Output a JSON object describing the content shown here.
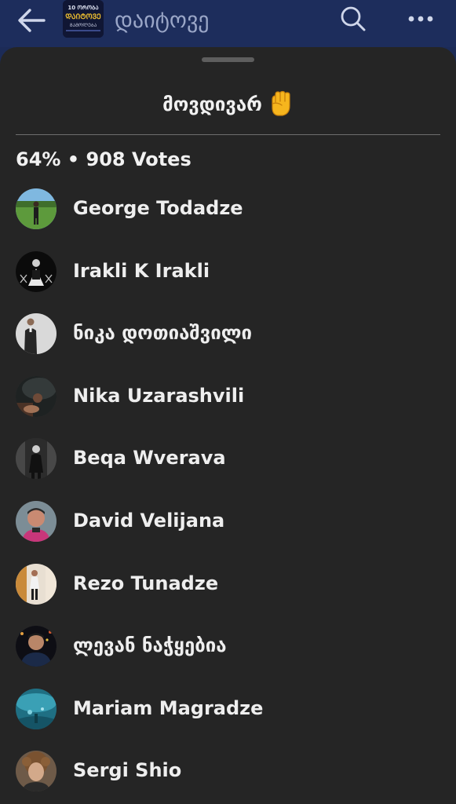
{
  "header": {
    "title": "დაიტოვე",
    "back_icon": "arrow-left-icon",
    "search_icon": "search-icon",
    "more_icon": "more-horizontal-icon",
    "thumb_text": [
      "10 ᲝᲠᲝᲑᲐ",
      "ᲓᲐᲘᲢᲝᲕᲔ",
      "ᲒᲐᲛᲝᲚᲔᲑᲐ"
    ]
  },
  "sheet": {
    "title": "მოვდივარ",
    "title_icon": "raised-fist-emoji",
    "summary": "64% • 908 Votes"
  },
  "voters": [
    {
      "name": "George Todadze",
      "avatar_icon": "person-on-grass-photo"
    },
    {
      "name": "Irakli K Irakli",
      "avatar_icon": "dark-portrait-photo"
    },
    {
      "name": "ნიკა დოთიაშვილი",
      "avatar_icon": "person-in-suit-photo"
    },
    {
      "name": "Nika Uzarashvili",
      "avatar_icon": "dark-outdoor-photo"
    },
    {
      "name": "Beqa Wverava",
      "avatar_icon": "person-dark-room-photo"
    },
    {
      "name": "David Velijana",
      "avatar_icon": "man-portrait-photo"
    },
    {
      "name": "Rezo Tunadze",
      "avatar_icon": "person-standing-photo"
    },
    {
      "name": "ლევან ნაჭყებია",
      "avatar_icon": "man-night-photo"
    },
    {
      "name": "Mariam Magradze",
      "avatar_icon": "aquarium-photo"
    },
    {
      "name": "Sergi Shio",
      "avatar_icon": "curly-hair-portrait-photo"
    }
  ],
  "colors": {
    "topbar_bg": "#1d2d5c",
    "sheet_bg": "#252525",
    "text": "#f1f1f1",
    "header_title": "#9aa6c7",
    "fist": "#f6b51d"
  }
}
